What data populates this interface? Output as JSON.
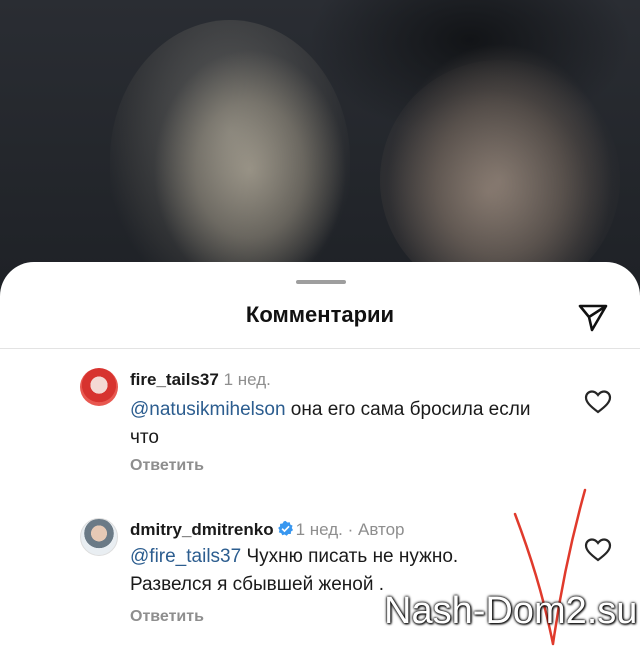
{
  "sheet": {
    "title": "Комментарии"
  },
  "comments": [
    {
      "username": "fire_tails37",
      "time": "1 нед.",
      "verified": false,
      "author_tag": "",
      "mention": "@natusikmihelson",
      "text": " она его сама бросила если что",
      "reply_label": "Ответить"
    },
    {
      "username": "dmitry_dmitrenko",
      "time": "1 нед.",
      "verified": true,
      "author_tag": " · Автор",
      "mention": "@fire_tails37",
      "text": " Чухню писать не нужно. Развелся я сбывшей женой .",
      "reply_label": "Ответить"
    }
  ],
  "watermark": "Nash-Dom2.su",
  "colors": {
    "mention": "#2c5d8f",
    "verified": "#3897f0",
    "red_mark": "#e03a2c"
  },
  "icons": [
    "send-icon",
    "heart-icon",
    "verified-badge-icon"
  ]
}
